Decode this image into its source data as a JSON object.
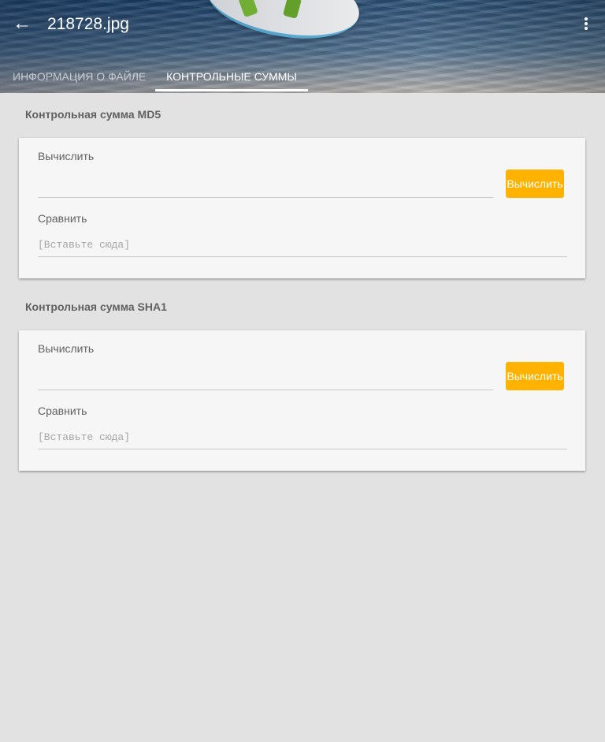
{
  "app_bar": {
    "title": "218728.jpg",
    "back_icon": "arrow-back-icon",
    "menu_icon": "more-vert-icon"
  },
  "tabs": [
    {
      "label": "ИНФОРМАЦИЯ О ФАЙЛЕ",
      "selected": false
    },
    {
      "label": "КОНТРОЛЬНЫЕ СУММЫ",
      "selected": true
    }
  ],
  "sections": {
    "md5": {
      "title": "Контрольная сумма MD5",
      "compute_label": "Вычислить",
      "compute_value": "",
      "compute_button": "Вычислить",
      "compare_label": "Сравнить",
      "compare_placeholder": "[Вставьте сюда]"
    },
    "sha1": {
      "title": "Контрольная сумма SHA1",
      "compute_label": "Вычислить",
      "compute_value": "",
      "compute_button": "Вычислить",
      "compare_label": "Сравнить",
      "compare_placeholder": "[Вставьте сюда]"
    }
  },
  "colors": {
    "accent": "#ffb300",
    "background": "#e2e2e2",
    "card": "#f6f6f6",
    "text_secondary": "#616161"
  }
}
